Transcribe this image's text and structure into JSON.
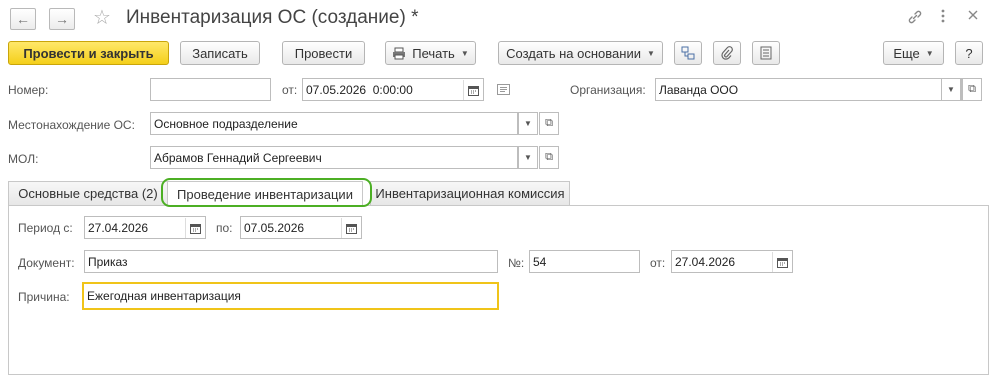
{
  "window": {
    "title": "Инвентаризация ОС (создание) *",
    "icons": [
      "back-arrow-icon",
      "forward-arrow-icon",
      "favorite-star-icon",
      "link-icon",
      "more-vertical-icon",
      "close-icon"
    ]
  },
  "toolbar": {
    "post_close": "Провести и закрыть",
    "save": "Записать",
    "post": "Провести",
    "print": "Печать",
    "create_based": "Создать на основании",
    "more": "Еще",
    "help": "?"
  },
  "header_fields": {
    "number_label": "Номер:",
    "number_value": "",
    "date_label": "от:",
    "date_value": "07.05.2026  0:00:00",
    "org_label": "Организация:",
    "org_value": "Лаванда ООО",
    "location_label": "Местонахождение ОС:",
    "location_value": "Основное подразделение",
    "mol_label": "МОЛ:",
    "mol_value": "Абрамов Геннадий Сергеевич"
  },
  "tabs": [
    {
      "label": "Основные средства (2)",
      "active": false
    },
    {
      "label": "Проведение инвентаризации",
      "active": true
    },
    {
      "label": "Инвентаризационная комиссия",
      "active": false
    }
  ],
  "inventory_tab": {
    "period_from_label": "Период с:",
    "period_from": "27.04.2026",
    "period_to_label": "по:",
    "period_to": "07.05.2026",
    "document_label": "Документ:",
    "document_value": "Приказ",
    "doc_number_label": "№:",
    "doc_number_value": "54",
    "doc_date_label": "от:",
    "doc_date_value": "27.04.2026",
    "reason_label": "Причина:",
    "reason_value": "Ежегодная инвентаризация"
  },
  "colors": {
    "primary_button": "#f4cf1a",
    "highlight_outline": "#4caf24",
    "focused_field_border": "#f0c419"
  }
}
